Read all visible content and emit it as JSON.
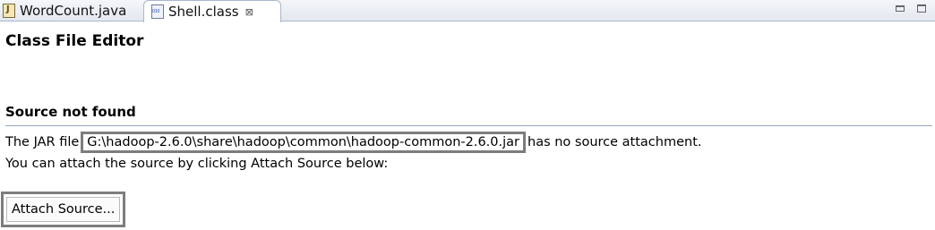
{
  "tabs": [
    {
      "label": "WordCount.java",
      "icon": "java-file-icon",
      "active": false
    },
    {
      "label": "Shell.class",
      "icon": "class-file-icon",
      "active": true,
      "close": "⊠"
    }
  ],
  "editor": {
    "title": "Class File Editor",
    "section_title": "Source not found",
    "message_prefix": "The JAR file",
    "jar_path": "G:\\hadoop-2.6.0\\share\\hadoop\\common\\hadoop-common-2.6.0.jar",
    "message_suffix": "has no source attachment.",
    "instruction": "You can attach the source by clicking Attach Source below:",
    "attach_button_label": "Attach Source..."
  },
  "colors": {
    "highlight_border": "#7d7d7d",
    "separator": "#98a8bf"
  }
}
